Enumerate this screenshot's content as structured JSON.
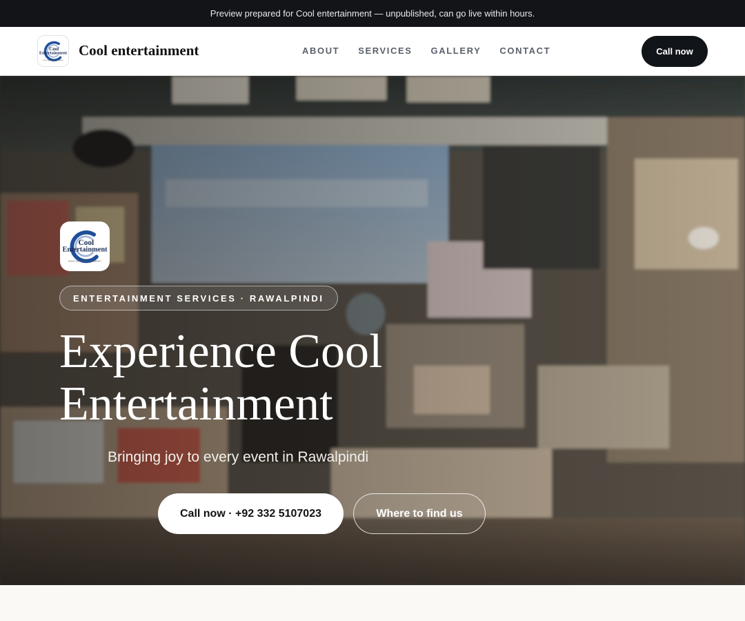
{
  "preview_banner": "Preview prepared for Cool entertainment — unpublished, can go live within hours.",
  "nav": {
    "brand": "Cool entertainment",
    "links": [
      "ABOUT",
      "SERVICES",
      "GALLERY",
      "CONTACT"
    ],
    "cta": "Call now"
  },
  "logo": {
    "line1": "Cool",
    "line2": "Entertainment",
    "tagline": "EVENT MANAGEMENT COMPANY",
    "icon": "swirl-logo-icon"
  },
  "hero": {
    "eyebrow": "ENTERTAINMENT SERVICES · RAWALPINDI",
    "headline_line1": "Experience Cool",
    "headline_line2": "Entertainment",
    "subline": "Bringing joy to every event in Rawalpindi",
    "primary_button": "Call now · +92 332 5107023",
    "secondary_button": "Where to find us",
    "background": "photo of a cluttered shop interior with curtains and posters"
  },
  "colors": {
    "topbar": "#121417",
    "cta_dark": "#111418",
    "logo_blue": "#1f4f9a",
    "logo_navy": "#1a2b55"
  }
}
